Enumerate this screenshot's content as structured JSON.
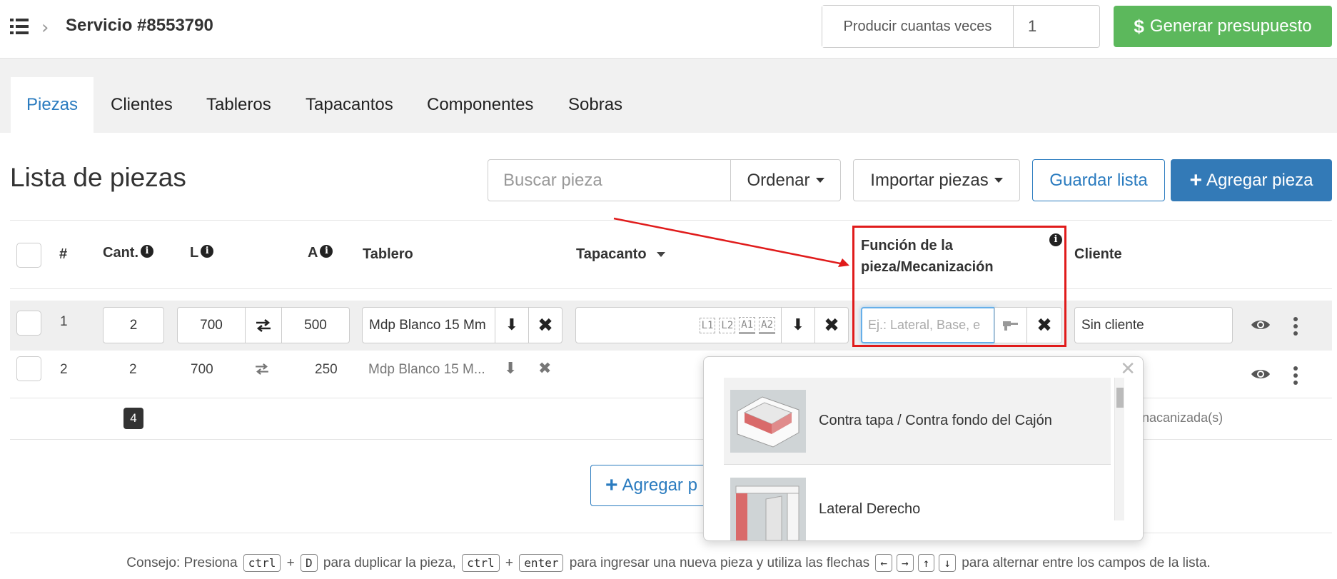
{
  "header": {
    "title": "Servicio #8553790",
    "produce_label": "Producir cuantas veces",
    "produce_value": "1",
    "generate_label": "Generar presupuesto"
  },
  "tabs": [
    {
      "label": "Piezas"
    },
    {
      "label": "Clientes"
    },
    {
      "label": "Tableros"
    },
    {
      "label": "Tapacantos"
    },
    {
      "label": "Componentes"
    },
    {
      "label": "Sobras"
    }
  ],
  "list": {
    "title": "Lista de piezas",
    "search_placeholder": "Buscar pieza",
    "order_label": "Ordenar",
    "import_label": "Importar piezas",
    "save_label": "Guardar lista",
    "add_label": "Agregar pieza"
  },
  "table": {
    "headers": {
      "num": "#",
      "qty": "Cant.",
      "length": "L",
      "width": "A",
      "board": "Tablero",
      "edge": "Tapacanto",
      "function_line1": "Función de la",
      "function_line2": "pieza/Mecanización",
      "client": "Cliente"
    },
    "rows": [
      {
        "num": "1",
        "qty": "2",
        "length": "700",
        "width": "500",
        "board": "Mdp Blanco 15 Mm",
        "edge_tags": [
          "L1",
          "L2",
          "A1",
          "A2"
        ],
        "function_placeholder": "Ej.: Lateral, Base, e",
        "client": "Sin cliente"
      },
      {
        "num": "2",
        "qty": "2",
        "length": "700",
        "width": "250",
        "board": "Mdp Blanco 15 M..."
      }
    ],
    "total_qty": "4",
    "machined_note": "nacanizada(s)"
  },
  "popup": {
    "items": [
      {
        "label": "Contra tapa / Contra fondo del Cajón"
      },
      {
        "label": "Lateral Derecho"
      }
    ]
  },
  "add_bottom_label": "Agregar p",
  "tip": {
    "part1": "Consejo: Presiona",
    "kbd_ctrl": "ctrl",
    "plus": "+",
    "kbd_d": "D",
    "part2": "para duplicar la pieza,",
    "kbd_enter": "enter",
    "part3": "para ingresar una nueva pieza y utiliza las flechas",
    "part4": "para alternar entre los campos de la lista."
  },
  "colors": {
    "primary": "#337ab7",
    "success": "#5cb85c",
    "highlight": "#e01b1b",
    "tab_active": "#2a7bbf"
  }
}
